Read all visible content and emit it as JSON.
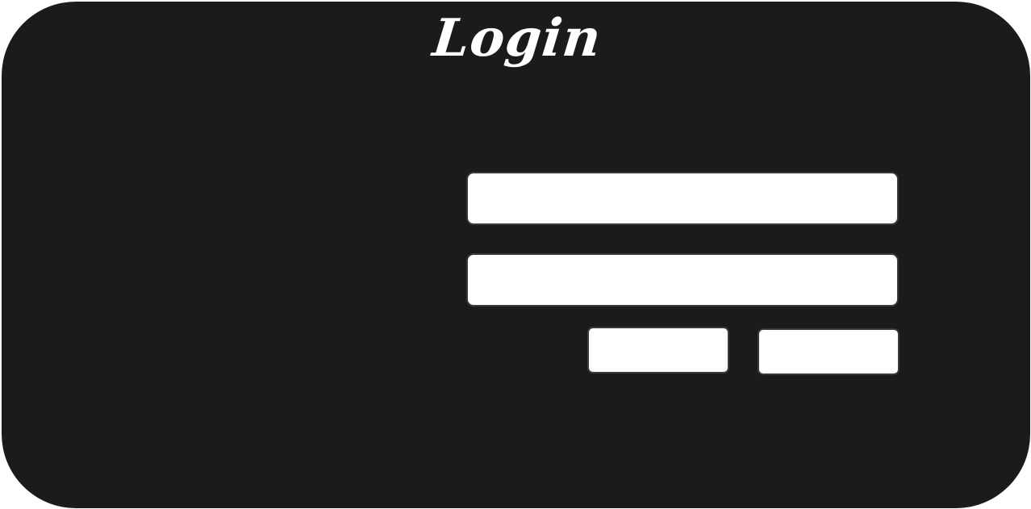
{
  "login": {
    "title": "Login",
    "username": {
      "value": "",
      "placeholder": ""
    },
    "password": {
      "value": "",
      "placeholder": ""
    },
    "buttons": {
      "primary_label": "",
      "secondary_label": ""
    }
  },
  "colors": {
    "panel_background": "#1b1b1b",
    "page_background": "#ffffff",
    "field_background": "#ffffff",
    "title_text": "#ffffff"
  }
}
